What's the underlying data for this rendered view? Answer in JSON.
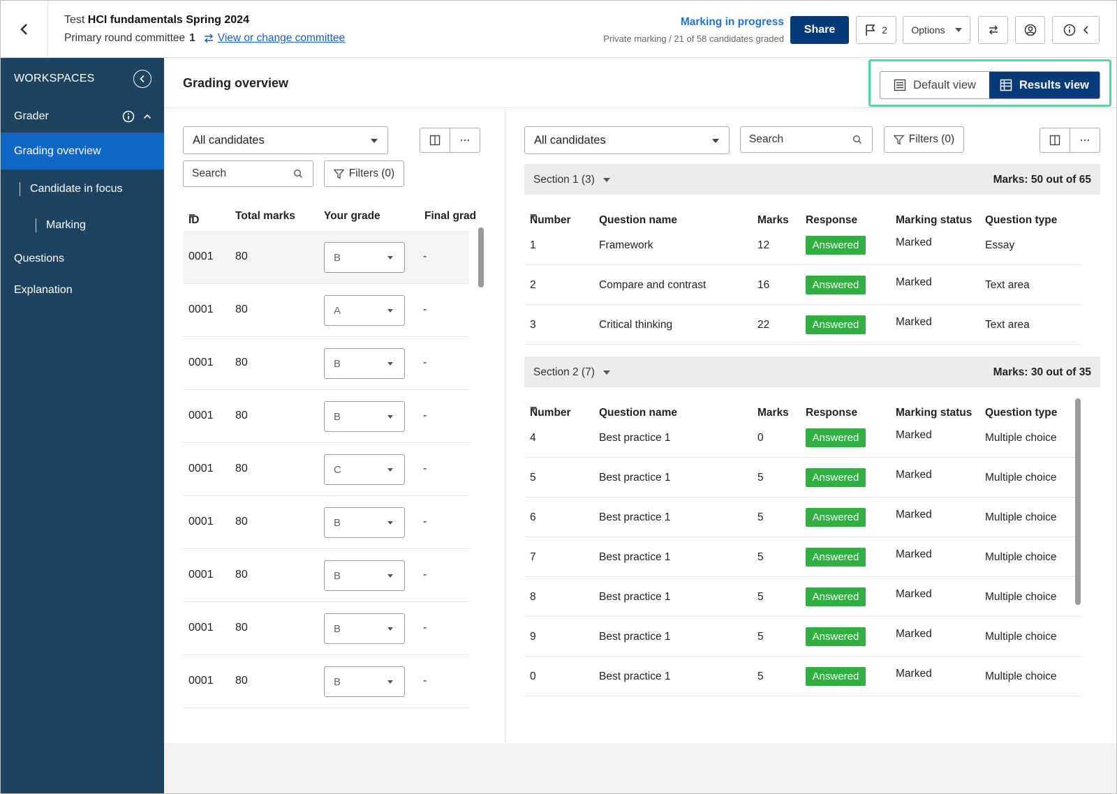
{
  "header": {
    "title_prefix": "Test",
    "title": "HCI fundamentals Spring 2024",
    "committee_label": "Primary round committee",
    "committee_number": "1",
    "change_committee_link": "View or change committee",
    "status_main": "Marking in progress",
    "status_sub": "Private marking /  21 of 58 candidates graded",
    "share_label": "Share",
    "flag_count": "2",
    "options_label": "Options"
  },
  "sidebar": {
    "workspaces_label": "WORKSPACES",
    "grader_label": "Grader",
    "items": [
      {
        "label": "Grading overview"
      },
      {
        "label": "Candidate in focus"
      },
      {
        "label": "Marking"
      },
      {
        "label": "Questions"
      },
      {
        "label": "Explanation"
      }
    ]
  },
  "main": {
    "page_title": "Grading overview",
    "default_view_label": "Default view",
    "results_view_label": "Results view"
  },
  "left_panel": {
    "candidates_select": "All candidates",
    "search_placeholder": "Search",
    "filters_label": "Filters (0)",
    "columns": {
      "id": "ID",
      "total_marks": "Total marks",
      "your_grade": "Your grade",
      "final_grade": "Final grad"
    },
    "rows": [
      {
        "id": "0001",
        "total_marks": "80",
        "grade": "B",
        "final": "-"
      },
      {
        "id": "0001",
        "total_marks": "80",
        "grade": "A",
        "final": "-"
      },
      {
        "id": "0001",
        "total_marks": "80",
        "grade": "B",
        "final": "-"
      },
      {
        "id": "0001",
        "total_marks": "80",
        "grade": "B",
        "final": "-"
      },
      {
        "id": "0001",
        "total_marks": "80",
        "grade": "C",
        "final": "-"
      },
      {
        "id": "0001",
        "total_marks": "80",
        "grade": "B",
        "final": "-"
      },
      {
        "id": "0001",
        "total_marks": "80",
        "grade": "B",
        "final": "-"
      },
      {
        "id": "0001",
        "total_marks": "80",
        "grade": "B",
        "final": "-"
      },
      {
        "id": "0001",
        "total_marks": "80",
        "grade": "B",
        "final": "-"
      }
    ]
  },
  "right_panel": {
    "candidates_select": "All candidates",
    "search_placeholder": "Search",
    "filters_label": "Filters (0)",
    "columns": {
      "number": "Number",
      "question_name": "Question name",
      "marks": "Marks",
      "response": "Response",
      "marking_status": "Marking status",
      "question_type": "Question type"
    },
    "sections": [
      {
        "label": "Section 1 (3)",
        "marks_summary": "Marks: 50 out of 65",
        "rows": [
          {
            "number": "1",
            "name": "Framework",
            "marks": "12",
            "response": "Answered",
            "status": "Marked",
            "type": "Essay"
          },
          {
            "number": "2",
            "name": "Compare and contrast",
            "marks": "16",
            "response": "Answered",
            "status": "Marked",
            "type": "Text area"
          },
          {
            "number": "3",
            "name": "Critical thinking",
            "marks": "22",
            "response": "Answered",
            "status": "Marked",
            "type": "Text area"
          }
        ]
      },
      {
        "label": "Section 2 (7)",
        "marks_summary": "Marks: 30 out of 35",
        "rows": [
          {
            "number": "4",
            "name": "Best practice 1",
            "marks": "0",
            "response": "Answered",
            "status": "Marked",
            "type": "Multiple choice"
          },
          {
            "number": "5",
            "name": "Best practice 1",
            "marks": "5",
            "response": "Answered",
            "status": "Marked",
            "type": "Multiple choice"
          },
          {
            "number": "6",
            "name": "Best practice 1",
            "marks": "5",
            "response": "Answered",
            "status": "Marked",
            "type": "Multiple choice"
          },
          {
            "number": "7",
            "name": "Best practice 1",
            "marks": "5",
            "response": "Answered",
            "status": "Marked",
            "type": "Multiple choice"
          },
          {
            "number": "8",
            "name": "Best practice 1",
            "marks": "5",
            "response": "Answered",
            "status": "Marked",
            "type": "Multiple choice"
          },
          {
            "number": "9",
            "name": "Best practice 1",
            "marks": "5",
            "response": "Answered",
            "status": "Marked",
            "type": "Multiple choice"
          },
          {
            "number": "0",
            "name": "Best practice 1",
            "marks": "5",
            "response": "Answered",
            "status": "Marked",
            "type": "Multiple choice"
          }
        ]
      }
    ]
  },
  "colors": {
    "sidebar_bg": "#1e4360",
    "nav_active": "#0f66c4",
    "primary_button": "#073a79",
    "answered_badge": "#2fb040",
    "highlight_outline": "#56d6a8",
    "link": "#1b5fb8"
  }
}
